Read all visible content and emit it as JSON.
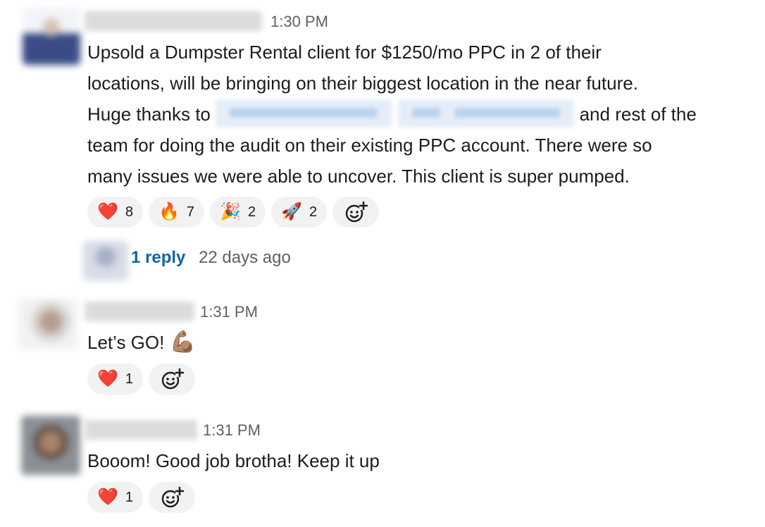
{
  "messages": [
    {
      "time": "1:30 PM",
      "text": {
        "line1": "Upsold a Dumpster Rental client for $1250/mo PPC in 2 of their",
        "line2": "locations, will be bringing on their biggest location in the near future.",
        "line3_start": "Huge thanks to",
        "line3_end": "and rest of the",
        "line4": "team for doing the audit on their existing PPC account. There were so",
        "line5": "many issues we were able to uncover. This client is super pumped."
      },
      "reactions": [
        {
          "emoji": "❤️",
          "count": "8"
        },
        {
          "emoji": "🔥",
          "count": "7"
        },
        {
          "emoji": "🎉",
          "count": "2"
        },
        {
          "emoji": "🚀",
          "count": "2"
        }
      ],
      "thread": {
        "reply_label": "1 reply",
        "last_reply": "22 days ago"
      }
    },
    {
      "time": "1:31 PM",
      "text": "Let’s GO!",
      "inline_emoji": "💪🏽",
      "reactions": [
        {
          "emoji": "❤️",
          "count": "1"
        }
      ]
    },
    {
      "time": "1:31 PM",
      "text": "Booom! Good job brotha! Keep it up",
      "reactions": [
        {
          "emoji": "❤️",
          "count": "1"
        }
      ]
    }
  ],
  "icons": {
    "add_reaction": "add-reaction-icon"
  },
  "colors": {
    "link": "#1264a3",
    "reaction_bg": "#f2f2f2",
    "timestamp": "#616061"
  }
}
